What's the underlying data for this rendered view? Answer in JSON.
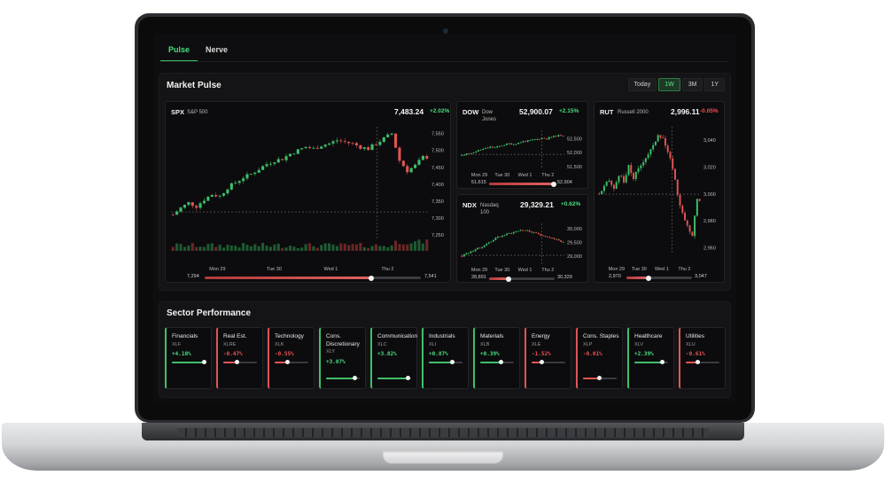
{
  "tabs": [
    {
      "label": "Pulse",
      "active": true
    },
    {
      "label": "Nerve",
      "active": false
    }
  ],
  "market_pulse": {
    "title": "Market Pulse",
    "timeframes": [
      {
        "label": "Today",
        "active": false
      },
      {
        "label": "1W",
        "active": true
      },
      {
        "label": "3M",
        "active": false
      },
      {
        "label": "1Y",
        "active": false
      }
    ],
    "indices": {
      "spx": {
        "ticker": "SPX",
        "name": "S&P 500",
        "price": "7,483.24",
        "change": "+2.02%",
        "direction": "up",
        "x_labels": [
          "Mon 29",
          "Tue 30",
          "Wed 1",
          "Thu 2"
        ],
        "y_labels": [
          "7,550",
          "7,500",
          "7,450",
          "7,400",
          "7,350",
          "7,300",
          "7,250"
        ],
        "y_range": [
          7240,
          7570
        ],
        "range_low": "7,294",
        "range_high": "7,541",
        "range_position": 0.77
      },
      "dow": {
        "ticker": "DOW",
        "name": "Dow Jones",
        "price": "52,900.07",
        "change": "+2.15%",
        "direction": "up",
        "x_labels": [
          "Mon 29",
          "Tue 30",
          "Wed 1",
          "Thu 2"
        ],
        "y_labels": [
          "52,500",
          "52,000",
          "51,500"
        ],
        "y_range": [
          51400,
          52800
        ],
        "range_low": "51,615",
        "range_high": "52,904",
        "range_position": 0.99
      },
      "ndx": {
        "ticker": "NDX",
        "name": "Nasdaq 100",
        "price": "29,329.21",
        "change": "+0.62%",
        "direction": "up",
        "x_labels": [
          "Mon 29",
          "Tue 30",
          "Wed 1",
          "Thu 2"
        ],
        "y_labels": [
          "30,000",
          "29,500",
          "29,000"
        ],
        "y_range": [
          28700,
          30200
        ],
        "range_low": "28,891",
        "range_high": "30,329",
        "range_position": 0.3
      },
      "rut": {
        "ticker": "RUT",
        "name": "Russell 2000",
        "price": "2,996.11",
        "change": "-0.05%",
        "direction": "down",
        "x_labels": [
          "Mon 29",
          "Tue 30",
          "Wed 1",
          "Thu 2"
        ],
        "y_labels": [
          "3,040",
          "3,020",
          "3,000",
          "2,980",
          "2,960"
        ],
        "y_range": [
          2955,
          3050
        ],
        "range_low": "2,970",
        "range_high": "3,047",
        "range_position": 0.34
      }
    }
  },
  "sector_performance": {
    "title": "Sector Performance",
    "sectors": [
      {
        "name": "Financials",
        "symbol": "XLF",
        "change": "+4.10%",
        "direction": "up",
        "level": 0.95
      },
      {
        "name": "Real Est.",
        "symbol": "XLRE",
        "change": "-0.47%",
        "direction": "down",
        "level": 0.4
      },
      {
        "name": "Technology",
        "symbol": "XLK",
        "change": "-0.55%",
        "direction": "down",
        "level": 0.38
      },
      {
        "name": "Cons. Discretionary",
        "symbol": "XLY",
        "change": "+3.07%",
        "direction": "up",
        "level": 0.85
      },
      {
        "name": "Communication",
        "symbol": "XLC",
        "change": "+3.82%",
        "direction": "up",
        "level": 0.92
      },
      {
        "name": "Industrials",
        "symbol": "XLI",
        "change": "+0.87%",
        "direction": "up",
        "level": 0.7
      },
      {
        "name": "Materials",
        "symbol": "XLB",
        "change": "+0.39%",
        "direction": "up",
        "level": 0.62
      },
      {
        "name": "Energy",
        "symbol": "XLE",
        "change": "-1.52%",
        "direction": "down",
        "level": 0.3
      },
      {
        "name": "Cons. Staples",
        "symbol": "XLP",
        "change": "-0.01%",
        "direction": "down",
        "level": 0.48
      },
      {
        "name": "Healthcare",
        "symbol": "XLV",
        "change": "+2.39%",
        "direction": "up",
        "level": 0.82
      },
      {
        "name": "Utilities",
        "symbol": "XLU",
        "change": "-0.61%",
        "direction": "down",
        "level": 0.36
      }
    ]
  },
  "colors": {
    "up": "#4ade80",
    "down": "#f05252",
    "accent": "#3fbf6a",
    "background": "#0e0e10"
  }
}
